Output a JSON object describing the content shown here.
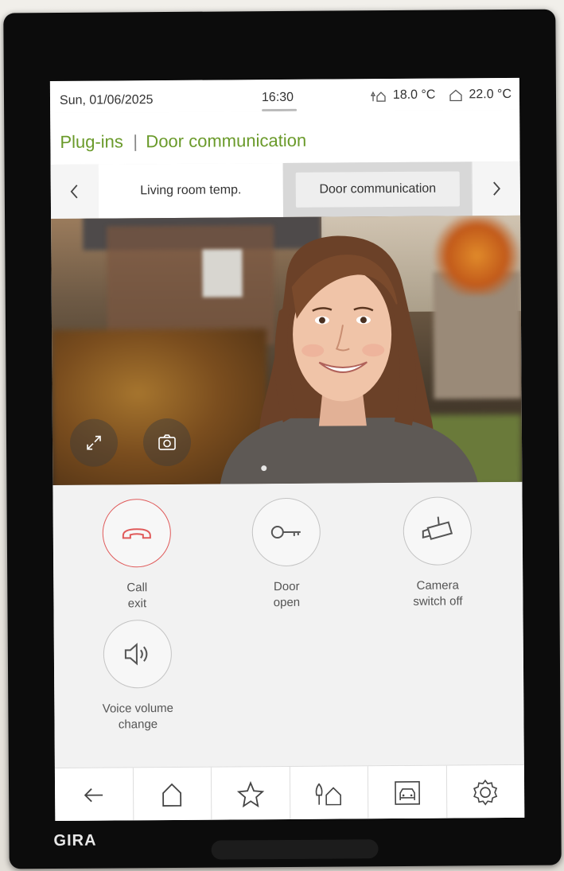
{
  "status": {
    "date": "Sun, 01/06/2025",
    "time": "16:30",
    "outdoor_temp": "18.0 °C",
    "indoor_temp": "22.0 °C"
  },
  "breadcrumb": {
    "section": "Plug-ins",
    "separator": "|",
    "page": "Door communication"
  },
  "tabs": {
    "prev_icon": "chevron-left-icon",
    "next_icon": "chevron-right-icon",
    "items": [
      {
        "label": "Living room temp.",
        "active": false
      },
      {
        "label": "Door communication",
        "active": true
      }
    ]
  },
  "camera": {
    "controls": [
      "expand-icon",
      "camera-snapshot-icon"
    ]
  },
  "actions": {
    "call_exit": {
      "line1": "Call",
      "line2": "exit",
      "icon": "hang-up-icon",
      "color": "#e05a5a"
    },
    "door_open": {
      "line1": "Door",
      "line2": "open",
      "icon": "key-icon"
    },
    "camera_off": {
      "line1": "Camera",
      "line2": "switch off",
      "icon": "camera-icon"
    },
    "voice_volume": {
      "line1": "Voice volume",
      "line2": "change",
      "icon": "speaker-icon"
    }
  },
  "nav": [
    "back-arrow-icon",
    "home-icon",
    "star-icon",
    "outdoor-home-icon",
    "garage-icon",
    "settings-gear-icon"
  ],
  "device": {
    "brand": "GIRA"
  },
  "colors": {
    "accent": "#6a9a2a",
    "call_red": "#e05a5a"
  }
}
